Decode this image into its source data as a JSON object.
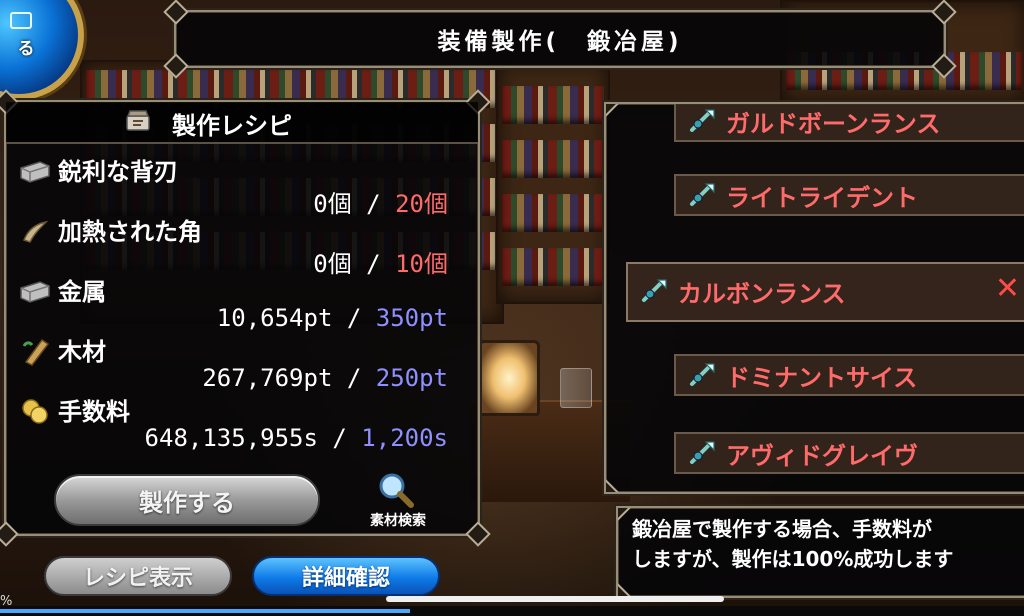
{
  "header": {
    "title": "装備製作(　鍛冶屋)",
    "back_orb_label": "る"
  },
  "recipe": {
    "title": "製作レシピ",
    "materials": [
      {
        "name": "鋭利な背刃",
        "have": "0個",
        "sep": " / ",
        "need": "20個",
        "need_color": "red",
        "icon": "blade-icon"
      },
      {
        "name": "加熱された角",
        "have": "0個",
        "sep": " / ",
        "need": "10個",
        "need_color": "red",
        "icon": "horn-icon"
      },
      {
        "name": "金属",
        "have": "10,654pt",
        "sep": " / ",
        "need": "350pt",
        "need_color": "blue",
        "icon": "metal-ingot-icon"
      },
      {
        "name": "木材",
        "have": "267,769pt",
        "sep": " / ",
        "need": "250pt",
        "need_color": "blue",
        "icon": "wood-log-icon"
      },
      {
        "name": "手数料",
        "have": "648,135,955s",
        "sep": " / ",
        "need": "1,200s",
        "need_color": "blue",
        "icon": "coin-icon"
      }
    ],
    "craft_button": "製作する",
    "search_button": "素材検索"
  },
  "bottom_buttons": {
    "recipe_view": "レシピ表示",
    "details": "詳細確認"
  },
  "item_list": {
    "items": [
      {
        "name": "ガルドボーンランス",
        "selected": false
      },
      {
        "name": "ライトライデント",
        "selected": false
      },
      {
        "name": "カルボンランス",
        "selected": true
      },
      {
        "name": "ドミナントサイス",
        "selected": false
      },
      {
        "name": "アヴィドグレイヴ",
        "selected": false
      }
    ]
  },
  "message": {
    "line1": "鍛冶屋で製作する場合、手数料が",
    "line2": "しますが、製作は100%成功します"
  },
  "progress": {
    "label": "%",
    "value": 0.4
  },
  "colors": {
    "need_red": "#ff6a6a",
    "need_blue": "#8f8fff",
    "item_text": "#ff6b6b",
    "frame_border": "#9a8d76",
    "primary_button": "#0f7be8"
  }
}
